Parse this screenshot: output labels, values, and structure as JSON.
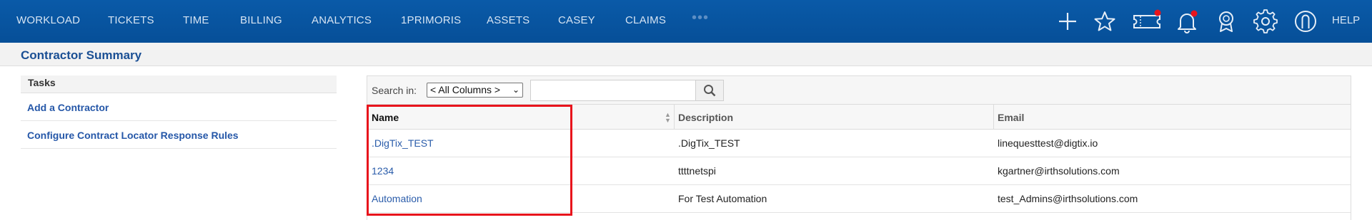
{
  "nav": {
    "items": [
      "WORKLOAD",
      "TICKETS",
      "TIME",
      "BILLING",
      "ANALYTICS",
      "1PRIMORIS",
      "ASSETS",
      "CASEY",
      "CLAIMS"
    ],
    "more": "•••",
    "help": "HELP",
    "icons": [
      "plus-icon",
      "star-icon",
      "ticket-icon",
      "bell-icon",
      "award-icon",
      "gear-icon",
      "user-icon"
    ],
    "badge_color": "#e8141c"
  },
  "page": {
    "title": "Contractor Summary"
  },
  "tasks": {
    "header": "Tasks",
    "links": [
      "Add a Contractor",
      "Configure Contract Locator Response Rules"
    ]
  },
  "grid": {
    "search_label": "Search in:",
    "search_select": "< All Columns >",
    "search_value": "",
    "columns": [
      "Name",
      "Description",
      "Email"
    ],
    "rows": [
      {
        "name": ".DigTix_TEST",
        "description": ".DigTix_TEST",
        "email": "linequesttest@digtix.io"
      },
      {
        "name": "1234",
        "description": "ttttnetspi",
        "email": "kgartner@irthsolutions.com"
      },
      {
        "name": "Automation",
        "description": "For Test Automation",
        "email": "test_Admins@irthsolutions.com"
      }
    ]
  },
  "colors": {
    "nav_bg": "#0a5aa8",
    "link": "#2a5caa",
    "highlight": "#e8141c"
  }
}
